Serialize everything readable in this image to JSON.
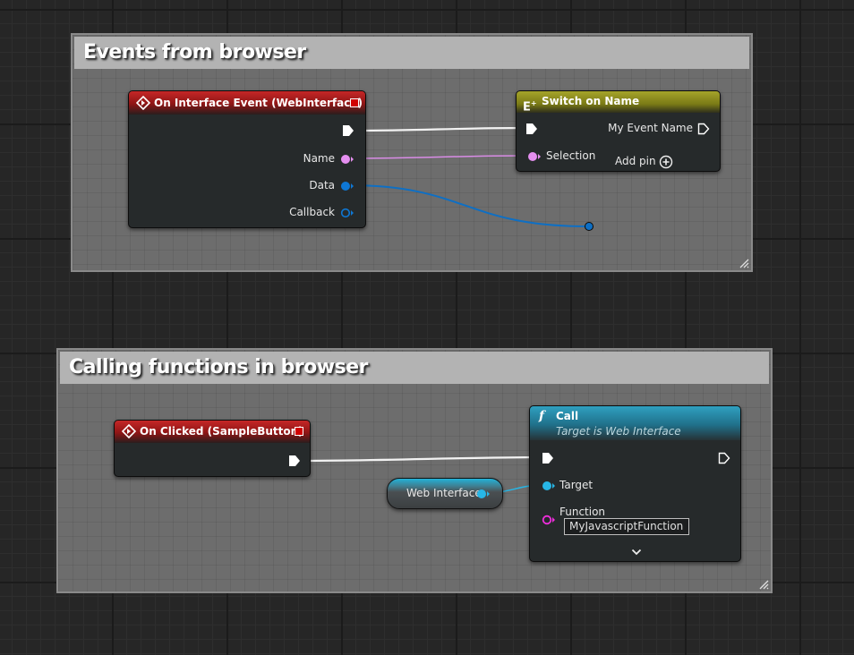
{
  "comments": {
    "events": {
      "title": "Events from browser"
    },
    "calling": {
      "title": "Calling functions in browser"
    }
  },
  "nodes": {
    "interface_event": {
      "title": "On Interface Event (WebInterface)",
      "pins": {
        "name": "Name",
        "data": "Data",
        "callback": "Callback"
      }
    },
    "switch_on_name": {
      "title": "Switch on Name",
      "pins": {
        "selection": "Selection",
        "my_event_name": "My Event Name",
        "add_pin": "Add pin"
      }
    },
    "on_clicked": {
      "title": "On Clicked (SampleButton)"
    },
    "web_interface_var": {
      "label": "Web Interface"
    },
    "call": {
      "title": "Call",
      "subtitle": "Target is Web Interface",
      "pins": {
        "target": "Target",
        "function": "Function"
      },
      "function_value": "MyJavascriptFunction"
    }
  },
  "colors": {
    "event_header": "#c52727",
    "switch_header": "#a5a42a",
    "function_header": "#2fa0c0",
    "name_pin": "#e58ff0",
    "struct_pin": "#0e77d4",
    "object_pin": "#27b6e6",
    "string_pin": "#ee2ddb",
    "exec_wire": "#ffffff"
  },
  "icons": {
    "event": "event-diamond-icon",
    "switch": "switch-enum-icon",
    "function": "function-f-icon",
    "add": "add-circle-icon",
    "expand": "chevron-down-icon",
    "resize": "resize-grip-icon"
  }
}
